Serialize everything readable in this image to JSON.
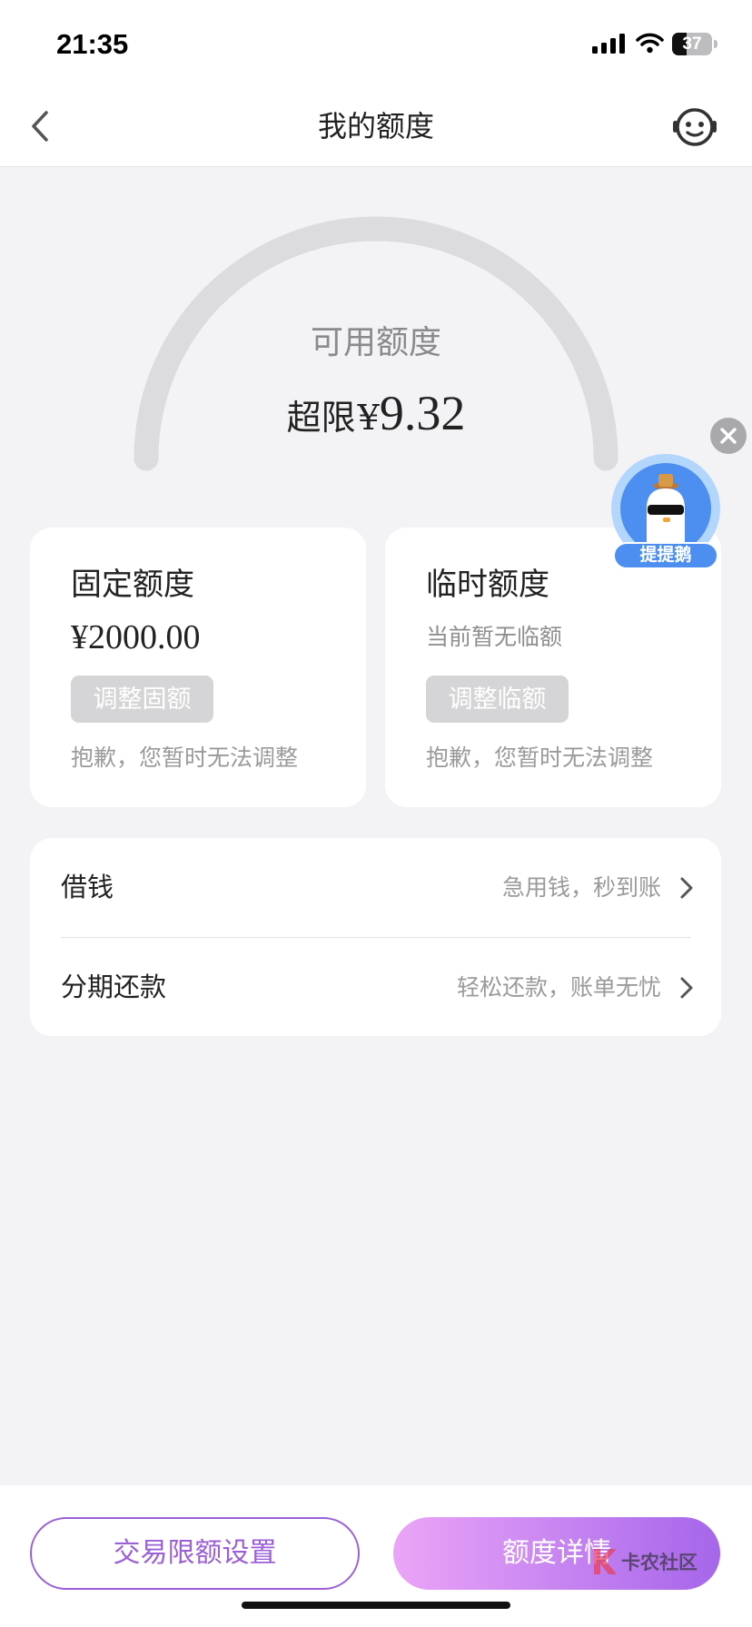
{
  "status_bar": {
    "time": "21:35",
    "battery": "37",
    "signal_icon": "cellular-signal-icon",
    "wifi_icon": "wifi-icon",
    "battery_icon": "battery-icon"
  },
  "nav": {
    "title": "我的额度",
    "back_icon": "chevron-left-icon",
    "service_icon": "customer-service-icon"
  },
  "gauge": {
    "label": "可用额度",
    "over_limit_label": "超限",
    "currency": "¥",
    "amount": "9.32"
  },
  "float_badge": {
    "label": "提提鹅",
    "icon": "duck-mascot-icon",
    "close_icon": "close-icon"
  },
  "cards": {
    "fixed": {
      "title": "固定额度",
      "value": "¥2000.00",
      "button": "调整固额",
      "note": "抱歉，您暂时无法调整"
    },
    "temp": {
      "title": "临时额度",
      "value": "当前暂无临额",
      "button": "调整临额",
      "note": "抱歉，您暂时无法调整"
    }
  },
  "list": [
    {
      "label": "借钱",
      "hint": "急用钱，秒到账",
      "icon": "chevron-right-icon"
    },
    {
      "label": "分期还款",
      "hint": "轻松还款，账单无忧",
      "icon": "chevron-right-icon"
    }
  ],
  "footer": {
    "limit_button": "交易限额设置",
    "detail_button": "额度详情"
  },
  "watermark": {
    "text": "卡农社区"
  },
  "colors": {
    "page_bg": "#f3f3f6",
    "accent": "#9b5fd8",
    "gauge_track": "#dcdcdf",
    "disabled_button": "#d5d5d7",
    "detail_gradient_start": "#eba5f7",
    "detail_gradient_end": "#a566ea",
    "badge_blue": "#4d8ff0"
  }
}
